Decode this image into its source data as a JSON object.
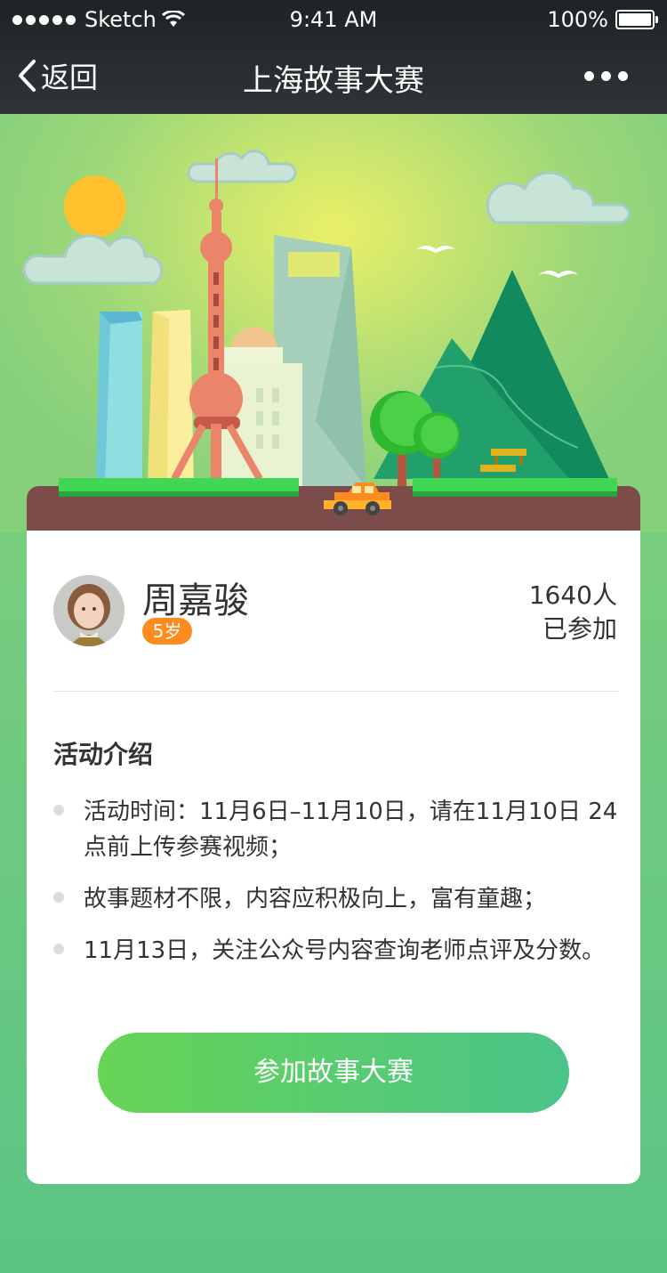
{
  "status_bar": {
    "carrier": "Sketch",
    "time": "9:41 AM",
    "battery": "100%"
  },
  "nav": {
    "back_label": "返回",
    "title": "上海故事大赛"
  },
  "profile": {
    "name": "周嘉骏",
    "age": "5岁",
    "participants_count": "1640人",
    "participants_label": "已参加"
  },
  "intro": {
    "title": "活动介绍",
    "items": [
      "活动时间：11月6日–11月10日，请在11月10日 24点前上传参赛视频；",
      "故事题材不限，内容应积极向上，富有童趣；",
      "11月13日，关注公众号内容查询老师点评及分数。"
    ]
  },
  "join_button": "参加故事大赛",
  "colors": {
    "badge": "#fd8b1f",
    "button_start": "#66d455",
    "button_end": "#4bc48a"
  }
}
